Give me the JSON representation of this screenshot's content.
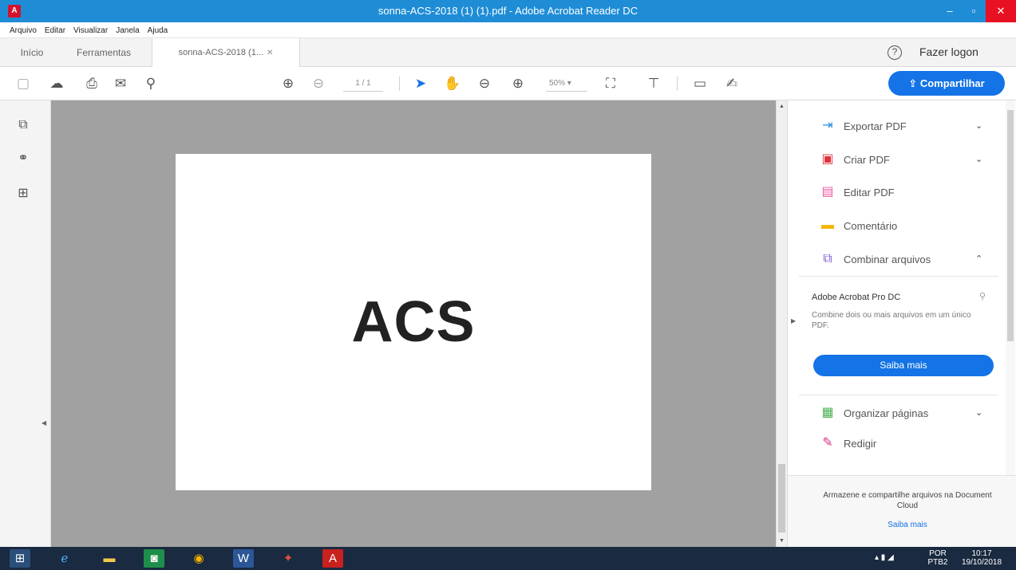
{
  "window": {
    "title": "sonna-ACS-2018 (1) (1).pdf - Adobe Acrobat Reader DC",
    "app_icon": "acrobat-icon",
    "controls": {
      "minimize": "–",
      "maximize": "▫",
      "close": "✕"
    }
  },
  "menu": [
    "Arquivo",
    "Editar",
    "Visualizar",
    "Janela",
    "Ajuda"
  ],
  "tabs": {
    "home": "Início",
    "tools": "Ferramentas",
    "doc": "sonna-ACS-2018 (1...",
    "doc_close": "✕"
  },
  "account": {
    "help": "?",
    "login": "Fazer logon"
  },
  "toolbar": {
    "page": "1 / 1",
    "zoom": "50% ▾",
    "share_label": "Compartilhar",
    "share_icon": "⇪"
  },
  "document": {
    "text": "ACS"
  },
  "right_panel": {
    "tools": [
      {
        "icon": "export-pdf-icon",
        "glyph": "⇥",
        "color": "#2a8dd8",
        "label": "Exportar PDF",
        "chevron": "⌄"
      },
      {
        "icon": "create-pdf-icon",
        "glyph": "▣",
        "color": "#e0323c",
        "label": "Criar PDF",
        "chevron": "⌄"
      },
      {
        "icon": "edit-pdf-icon",
        "glyph": "▤",
        "color": "#e85aa0",
        "label": "Editar PDF",
        "chevron": ""
      },
      {
        "icon": "comment-icon",
        "glyph": "▬",
        "color": "#f2b705",
        "label": "Comentário",
        "chevron": ""
      },
      {
        "icon": "combine-files-icon",
        "glyph": "⧉",
        "color": "#7b5cd6",
        "label": "Combinar arquivos",
        "chevron": "⌃"
      }
    ],
    "promo": {
      "title": "Adobe Acrobat Pro DC",
      "text": "Combine dois ou mais arquivos em um único PDF.",
      "pin": "⚲",
      "button": "Saiba mais"
    },
    "tools_more": [
      {
        "icon": "organize-pages-icon",
        "glyph": "▦",
        "color": "#4caf50",
        "label": "Organizar páginas",
        "chevron": "⌄"
      },
      {
        "icon": "redact-icon",
        "glyph": "✎",
        "color": "#d6338a",
        "label": "Redigir",
        "chevron": ""
      }
    ],
    "document_cloud": {
      "text": "Armazene e compartilhe arquivos na Document Cloud",
      "link": "Saiba mais"
    }
  },
  "taskbar": {
    "tray_lang": "POR\nPTB2",
    "tray_time": "10:17\n19/10/2018"
  }
}
